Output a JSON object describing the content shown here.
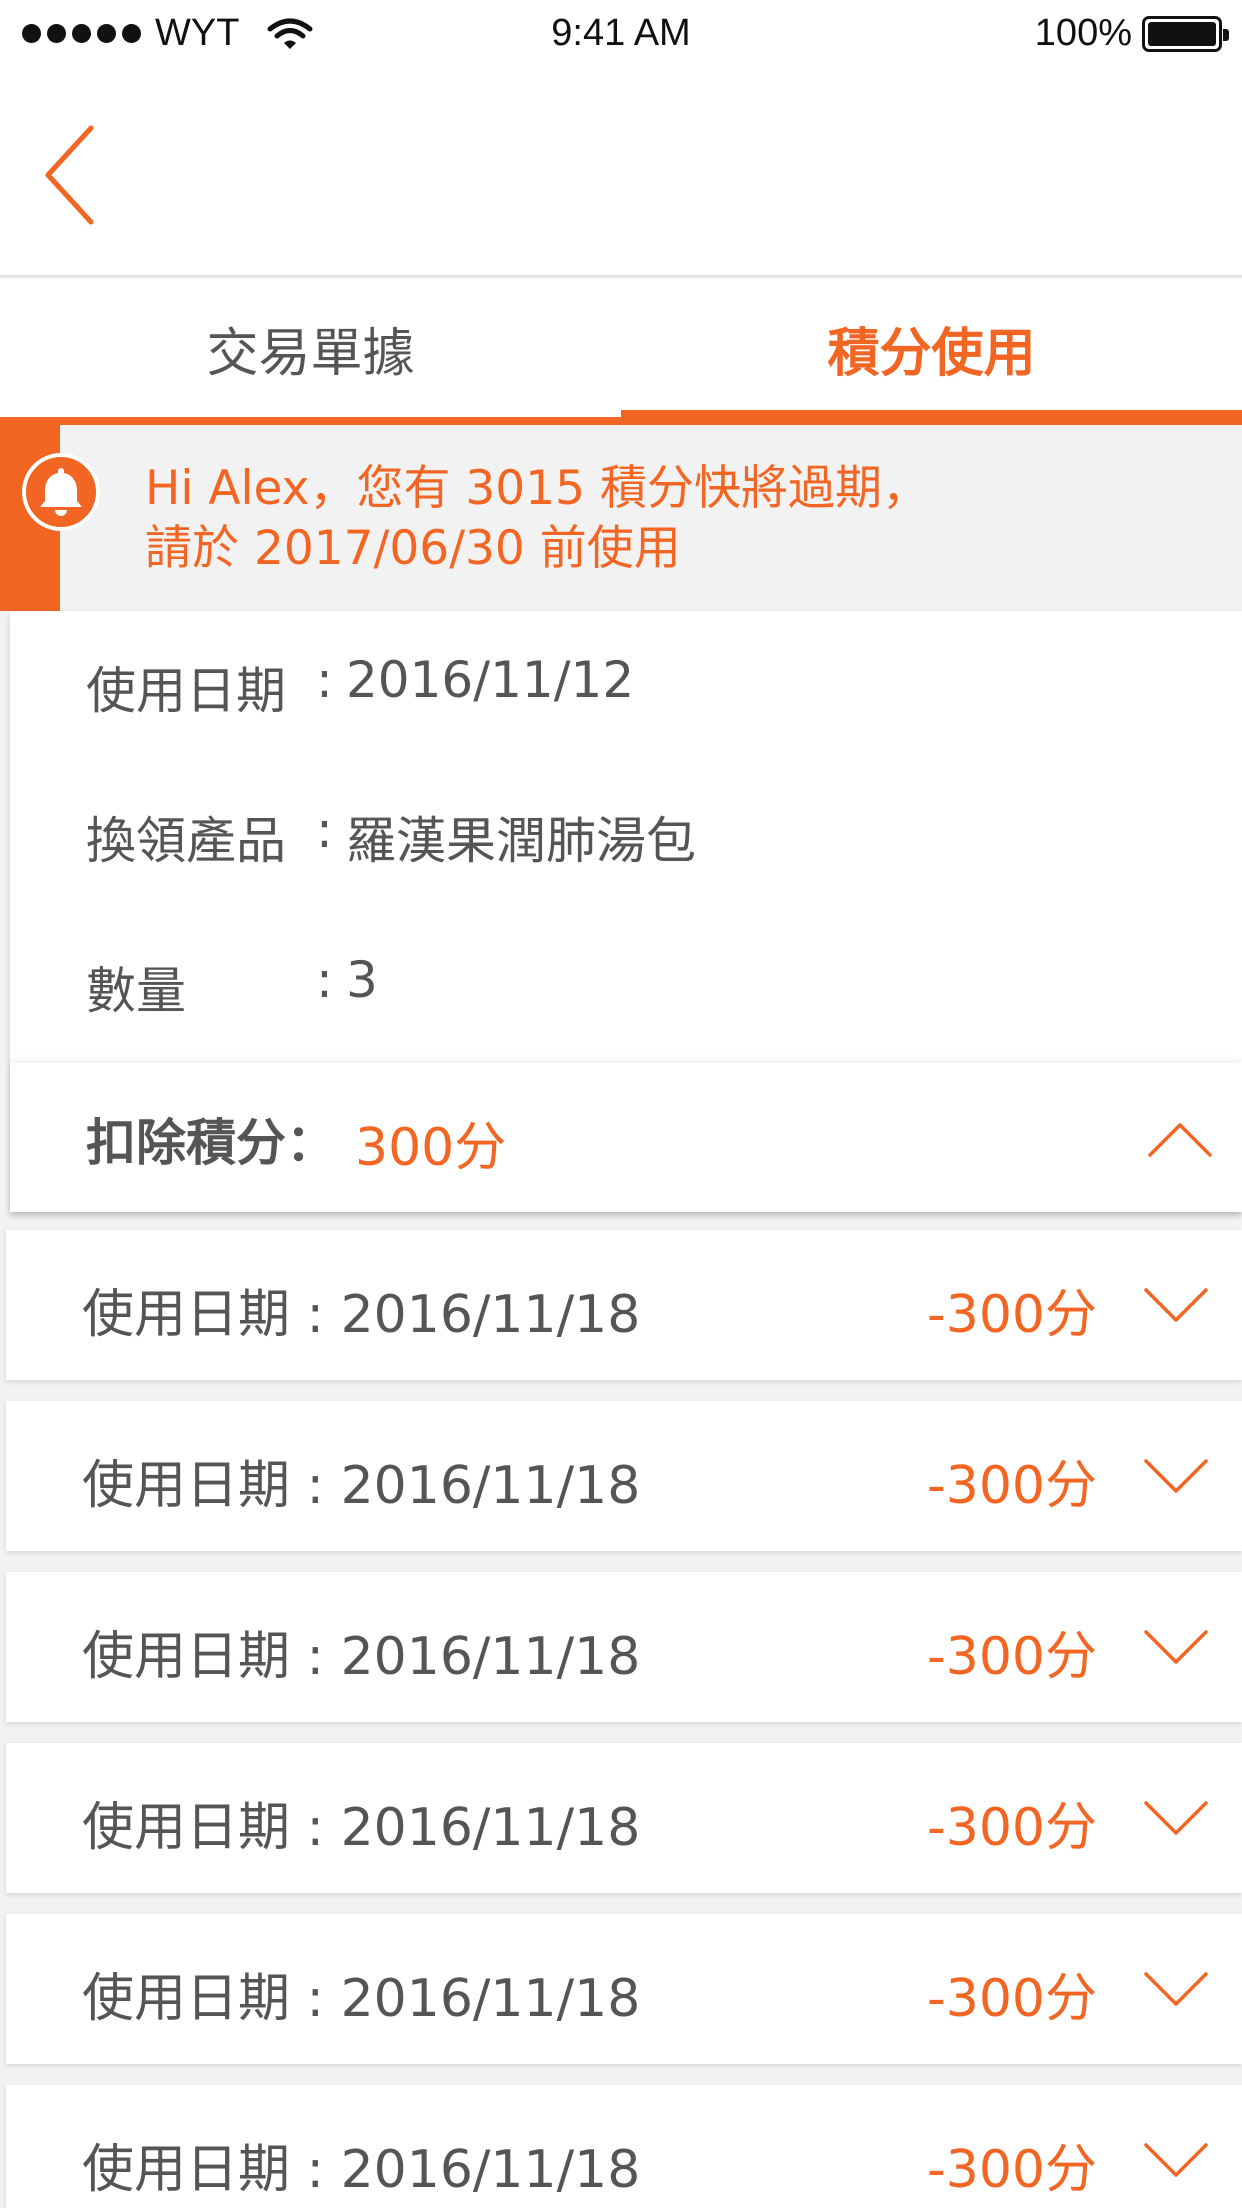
{
  "status_bar": {
    "carrier": "WYT",
    "time": "9:41 AM",
    "battery": "100%"
  },
  "tabs": [
    {
      "label": "交易單據",
      "active": false
    },
    {
      "label": "積分使用",
      "active": true
    }
  ],
  "alert": {
    "line1": "Hi Alex，您有 3015 積分快將過期，",
    "line2": "請於 2017/06/30 前使用"
  },
  "expanded": {
    "date_label": "使用日期",
    "date_value": "2016/11/12",
    "product_label": "換領產品",
    "product_value": "羅漢果潤肺湯包",
    "qty_label": "數量",
    "qty_value": "3",
    "colon": ":",
    "deduct_label": "扣除積分：",
    "deduct_value": "300分"
  },
  "records": [
    {
      "label": "使用日期 : 2016/11/18",
      "points": "-300分"
    },
    {
      "label": "使用日期 : 2016/11/18",
      "points": "-300分"
    },
    {
      "label": "使用日期 : 2016/11/18",
      "points": "-300分"
    },
    {
      "label": "使用日期 : 2016/11/18",
      "points": "-300分"
    },
    {
      "label": "使用日期 : 2016/11/18",
      "points": "-300分"
    },
    {
      "label": "使用日期 : 2016/11/18",
      "points": "-300分"
    }
  ],
  "colors": {
    "accent": "#f26522",
    "text": "#555555",
    "background": "#f2f2f2"
  }
}
